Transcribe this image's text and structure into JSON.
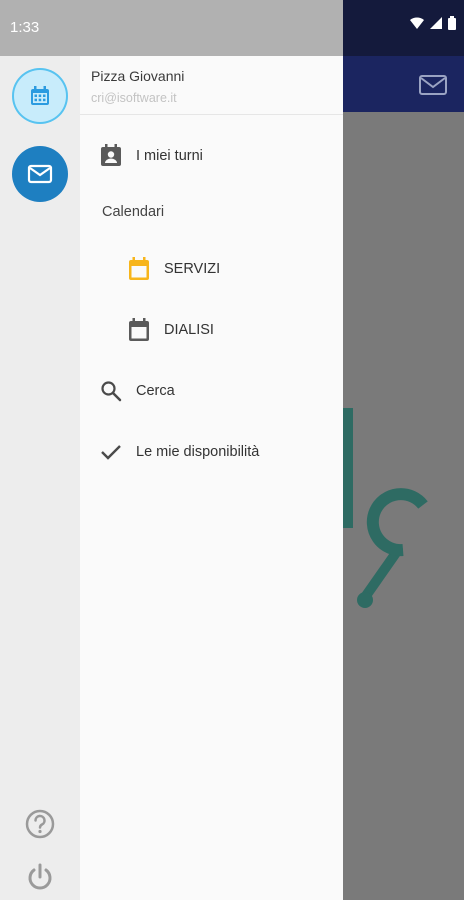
{
  "status": {
    "time": "1:33"
  },
  "user": {
    "name": "Pizza Giovanni",
    "email": "cri@isoftware.it"
  },
  "menu": {
    "my_shifts": "I miei turni",
    "calendars_section": "Calendari",
    "calendars": [
      {
        "label": "SERVIZI",
        "color": "#f7b51b"
      },
      {
        "label": "DIALISI",
        "color": "#5a5a5a"
      }
    ],
    "search": "Cerca",
    "availability": "Le mie disponibilità"
  },
  "rail": {
    "calendar_icon": "calendar-icon",
    "mail_icon": "mail-icon",
    "help_icon": "help-icon",
    "power_icon": "power-icon"
  },
  "colors": {
    "rail_active": "#58c3f0",
    "rail_mail": "#1e7fc1",
    "appbar": "#1b2560",
    "bg_art": "#2e6b63"
  }
}
